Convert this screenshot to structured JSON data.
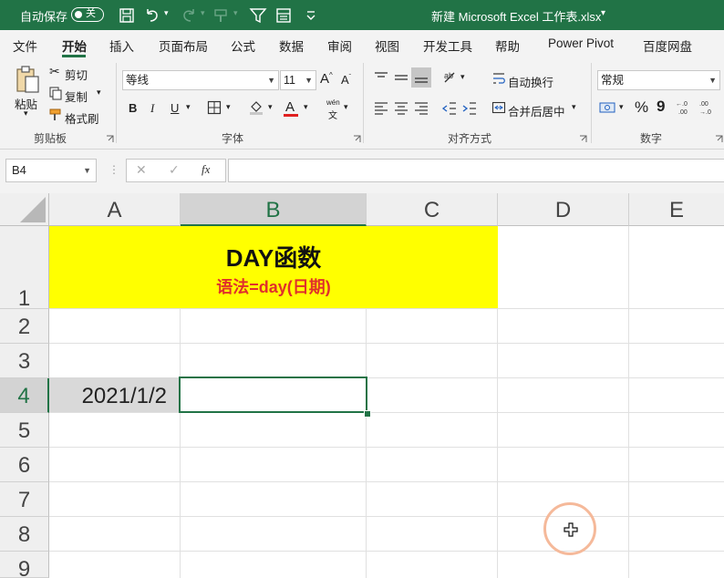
{
  "title_bar": {
    "autosave_label": "自动保存",
    "autosave_state": "关",
    "document_title": "新建 Microsoft Excel 工作表.xlsx",
    "title_dropdown_glyph": "▾",
    "quick_access_icons": [
      "save-icon",
      "undo-icon",
      "redo-icon",
      "format-painter-icon",
      "filter-icon",
      "form-icon",
      "customize-icon"
    ]
  },
  "ribbon_tabs": [
    "文件",
    "开始",
    "插入",
    "页面布局",
    "公式",
    "数据",
    "审阅",
    "视图",
    "开发工具",
    "帮助",
    "Power Pivot",
    "百度网盘"
  ],
  "active_tab": "开始",
  "clipboard": {
    "paste_label": "粘贴",
    "cut_label": "剪切",
    "copy_label": "复制",
    "format_painter_label": "格式刷",
    "group_label": "剪贴板"
  },
  "font": {
    "font_name": "等线",
    "font_size": "11",
    "grow_label": "A",
    "shrink_label": "A",
    "bold_label": "B",
    "italic_label": "I",
    "underline_label": "U",
    "font_color_label": "A",
    "phonetic_top": "wén",
    "phonetic_bottom": "文",
    "group_label": "字体"
  },
  "alignment": {
    "wrap_label": "自动换行",
    "merge_label": "合并后居中",
    "group_label": "对齐方式"
  },
  "number": {
    "format_value": "常规",
    "percent_label": "%",
    "comma_label": "9",
    "group_label": "数字"
  },
  "formula_bar": {
    "name_box": "B4",
    "fx_label": "fx",
    "formula_value": ""
  },
  "sheet": {
    "columns": [
      "A",
      "B",
      "C",
      "D",
      "E"
    ],
    "rows": [
      "1",
      "2",
      "3",
      "4",
      "5",
      "6",
      "7",
      "8",
      "9"
    ],
    "selected_cell": "B4",
    "title_cell": "DAY函数",
    "syntax_cell": "语法=day(日期)",
    "a4_value": "2021/1/2",
    "b4_value": "",
    "highlight_color": "#ffff00",
    "syntax_color": "#e0302b",
    "accent_color": "#217346"
  }
}
